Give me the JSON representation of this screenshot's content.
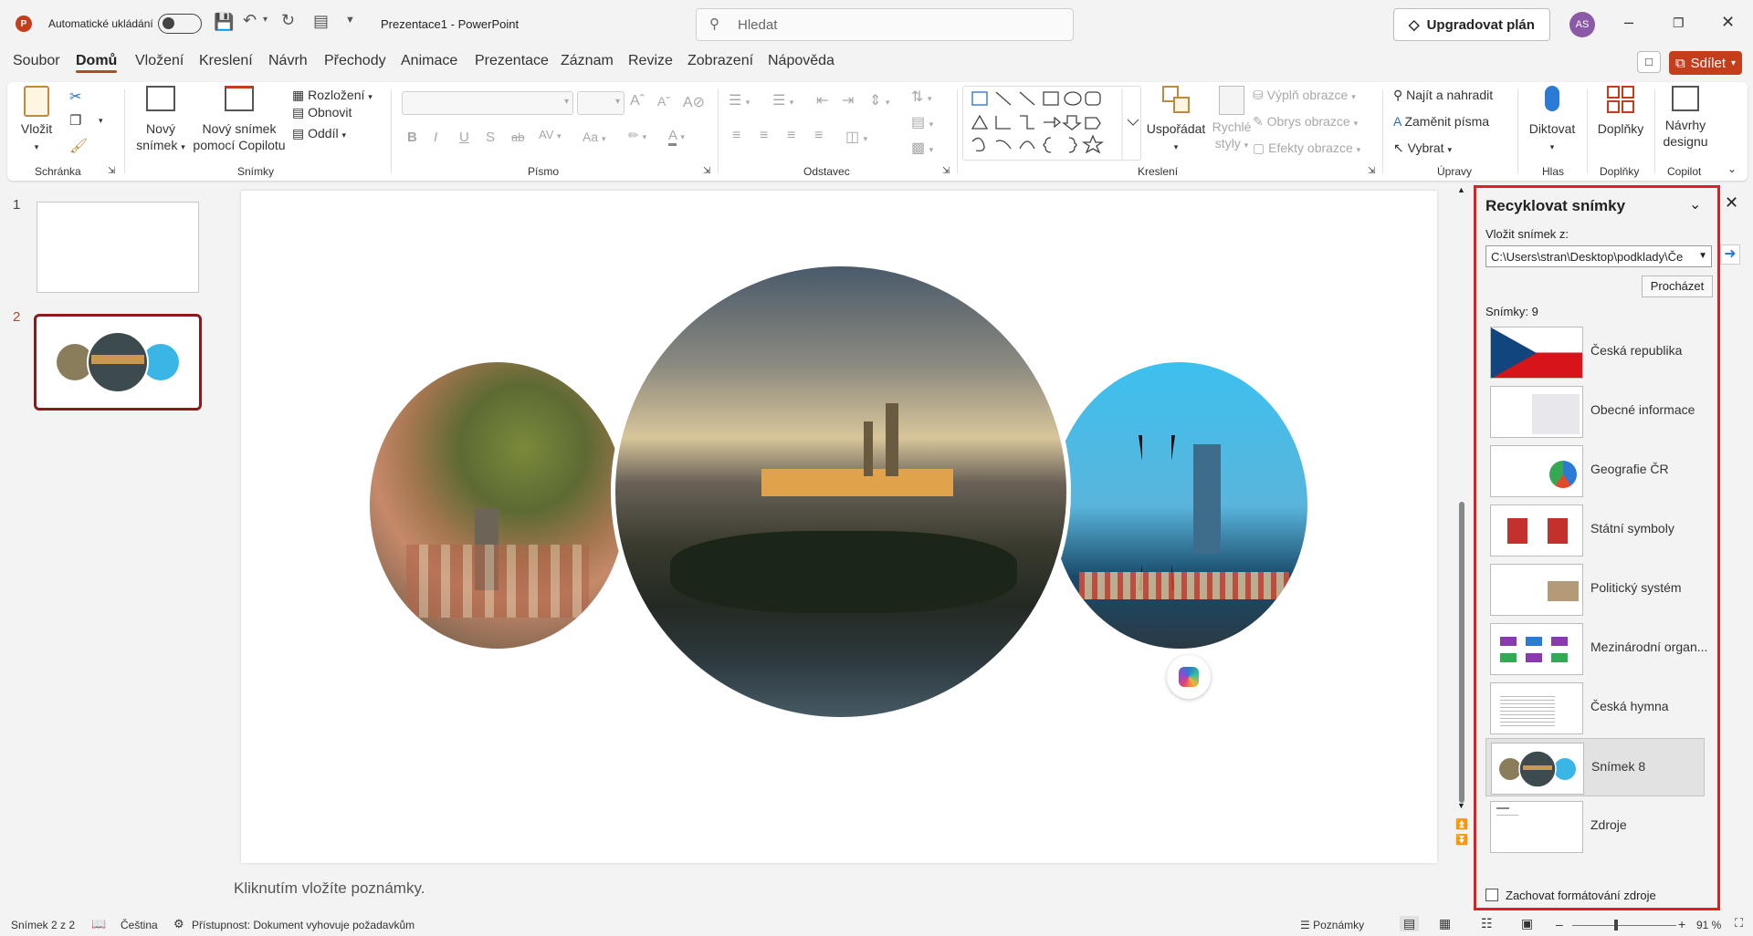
{
  "titlebar": {
    "autosave_label": "Automatické ukládání",
    "doc_title": "Prezentace1",
    "separator": "-",
    "app_name": "PowerPoint",
    "search_placeholder": "Hledat",
    "upgrade_label": "Upgradovat plán",
    "avatar_initials": "AS"
  },
  "menu": {
    "tabs": [
      "Soubor",
      "Domů",
      "Vložení",
      "Kreslení",
      "Návrh",
      "Přechody",
      "Animace",
      "Prezentace",
      "Záznam",
      "Revize",
      "Zobrazení",
      "Nápověda"
    ],
    "active": "Domů",
    "share_label": "Sdílet"
  },
  "ribbon": {
    "groups": {
      "schranka": "Schránka",
      "snimky": "Snímky",
      "pismo": "Písmo",
      "odstavec": "Odstavec",
      "kresleni": "Kreslení",
      "upravy": "Úpravy",
      "hlas": "Hlas",
      "doplnky": "Doplňky",
      "copilot": "Copilot"
    },
    "vlozit": "Vložit",
    "novy_snimek_1": "Nový",
    "novy_snimek_2": "snímek",
    "copilot_snimek_1": "Nový snímek",
    "copilot_snimek_2": "pomocí Copilotu",
    "rozlozeni": "Rozložení",
    "obnovit": "Obnovit",
    "oddil": "Oddíl",
    "usporadat": "Uspořádat",
    "rychle_styly_1": "Rychlé",
    "rychle_styly_2": "styly",
    "vypln": "Výplň obrazce",
    "obrys": "Obrys obrazce",
    "efekty": "Efekty obrazce",
    "najit": "Najít a nahradit",
    "zamenit": "Zaměnit písma",
    "vybrat": "Vybrat",
    "diktovat": "Diktovat",
    "doplnky": "Doplňky",
    "navrhy_1": "Návrhy",
    "navrhy_2": "designu",
    "font_b": "B",
    "font_i": "I",
    "font_u": "U",
    "font_s": "S",
    "font_ab": "ab",
    "font_av": "AV",
    "font_aa": "Aa",
    "font_a": "A"
  },
  "thumbnails": [
    {
      "num": "1"
    },
    {
      "num": "2"
    }
  ],
  "notes_placeholder": "Kliknutím vložíte poznámky.",
  "pane": {
    "title": "Recyklovat snímky",
    "insert_from_label": "Vložit snímek z:",
    "path": "C:\\Users\\stran\\Desktop\\podklady\\Če",
    "browse": "Procházet",
    "count_label": "Snímky: 9",
    "slides": [
      {
        "label": "Česká republika"
      },
      {
        "label": "Obecné informace"
      },
      {
        "label": "Geografie ČR"
      },
      {
        "label": "Státní symboly"
      },
      {
        "label": "Politický systém"
      },
      {
        "label": "Mezinárodní organ..."
      },
      {
        "label": "Česká hymna"
      },
      {
        "label": "Snímek 8"
      },
      {
        "label": "Zdroje"
      }
    ],
    "keep_format": "Zachovat formátování zdroje"
  },
  "status": {
    "slide": "Snímek 2 z 2",
    "language": "Čeština",
    "accessibility": "Přístupnost: Dokument vyhovuje požadavkům",
    "notes": "Poznámky",
    "zoom": "91 %"
  },
  "colors": {
    "accent": "#b7472a",
    "pane_border": "#e02020",
    "share_bg": "#c43e1c"
  }
}
